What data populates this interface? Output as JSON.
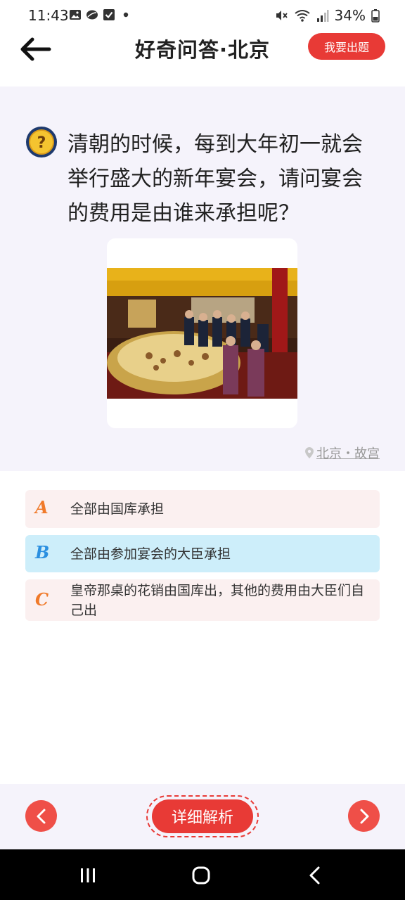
{
  "status_bar": {
    "time": "11:43",
    "battery": "34%"
  },
  "header": {
    "title": "好奇问答·北京",
    "make_question_label": "我要出题"
  },
  "question": {
    "text": "清朝的时候，每到大年初一就会举行盛大的新年宴会，请问宴会的费用是由谁来承担呢？",
    "location": "北京・故宫"
  },
  "options": [
    {
      "letter": "A",
      "letter_color": "#f07a2a",
      "text": "全部由国库承担"
    },
    {
      "letter": "B",
      "letter_color": "#2a8fe0",
      "text": "全部由参加宴会的大臣承担"
    },
    {
      "letter": "C",
      "letter_color": "#f07a2a",
      "text": "皇帝那桌的花销由国库出，其他的费用由大臣们自己出"
    }
  ],
  "bottom_bar": {
    "detail_label": "详细解析"
  },
  "colors": {
    "accent": "#e83a36",
    "question_bg": "#f5f3fb",
    "option_bg": "#fbf0f0",
    "selected_option_bg": "#cdeefa"
  }
}
